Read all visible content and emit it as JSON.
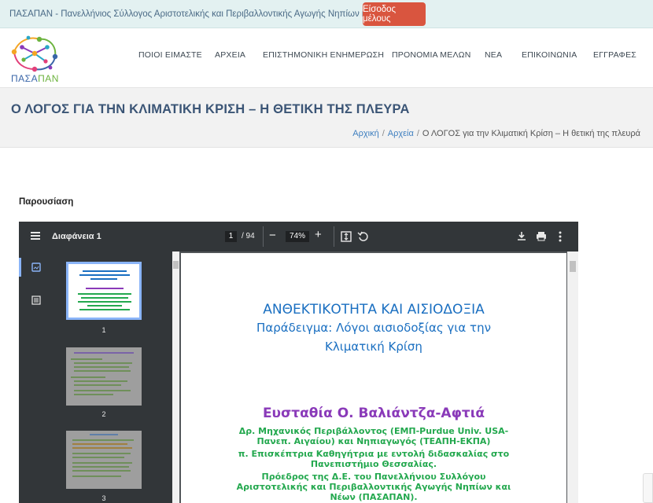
{
  "topbar": {
    "text": "ΠΑΣΑΠΑΝ - Πανελλήνιος Σύλλογος Αριστοτελικής και Περιβαλλοντικής Αγωγής Νηπίων και Νέων",
    "login_label": "Είσοδος μέλους"
  },
  "logo": {
    "part1": "ΠΑΣΑ",
    "part2": "ΠΑΝ"
  },
  "nav": {
    "items": [
      "ΠΟΙΟΙ ΕΙΜΑΣΤΕ",
      "ΑΡΧΕΙΑ",
      "ΕΠΙΣΤΗΜΟΝΙΚΗ ΕΝΗΜΕΡΩΣΗ",
      "ΠΡΟΝΟΜΙΑ ΜΕΛΩΝ",
      "ΝΕΑ",
      "ΕΠΙΚΟΙΝΩΝΙΑ",
      "ΕΓΓΡΑΦΕΣ"
    ]
  },
  "page": {
    "title": "Ο ΛΟΓΟΣ ΓΙΑ ΤΗΝ ΚΛΙΜΑΤΙΚΗ ΚΡΙΣΗ – Η ΘΕΤΙΚΗ ΤΗΣ ΠΛΕΥΡΑ",
    "breadcrumb": [
      "Αρχική",
      "Αρχεία",
      "Ο ΛΟΓΟΣ για την Κλιματική Κρίση – Η θετική της πλευρά"
    ],
    "breadcrumb_sep": "/",
    "section_label": "Παρουσίαση"
  },
  "viewer": {
    "doc_title": "Διαφάνεια 1",
    "current_page": "1",
    "total_pages": "/ 94",
    "zoom": "74%",
    "zoom_out": "−",
    "zoom_in": "+",
    "thumbnails": [
      "1",
      "2",
      "3"
    ],
    "colors": {
      "toolbar": "#323639",
      "canvas": "#525659",
      "accent": "#8ab4f8"
    }
  },
  "slide": {
    "title_line1": "ΑΝΘΕΚΤΙΚΟΤΗΤΑ ΚΑΙ ΑΙΣΙΟΔΟΞΙΑ",
    "title_line2": "Παράδειγμα: Λόγοι αισιοδοξίας για την",
    "title_line3": "Κλιματική Κρίση",
    "author": "Ευσταθία Ο. Βαλιάντζα-Αφτιά",
    "info": [
      "Δρ. Μηχανικός Περιβάλλοντος (ΕΜΠ-Purdue Univ. USA-",
      "Πανεπ. Αιγαίου) και Νηπιαγωγός (ΤΕΑΠΗ-ΕΚΠΑ)",
      "π. Επισκέπτρια Καθηγήτρια με εντολή διδασκαλίας στο",
      "Πανεπιστήμιο Θεσσαλίας.",
      "Πρόεδρος της Δ.Ε. του Πανελλήνιου Συλλόγου",
      "Αριστοτελικής και Περιβαλλοντικής Αγωγής Νηπίων και",
      "Νέων (ΠΑΣΑΠΑΝ)."
    ]
  }
}
